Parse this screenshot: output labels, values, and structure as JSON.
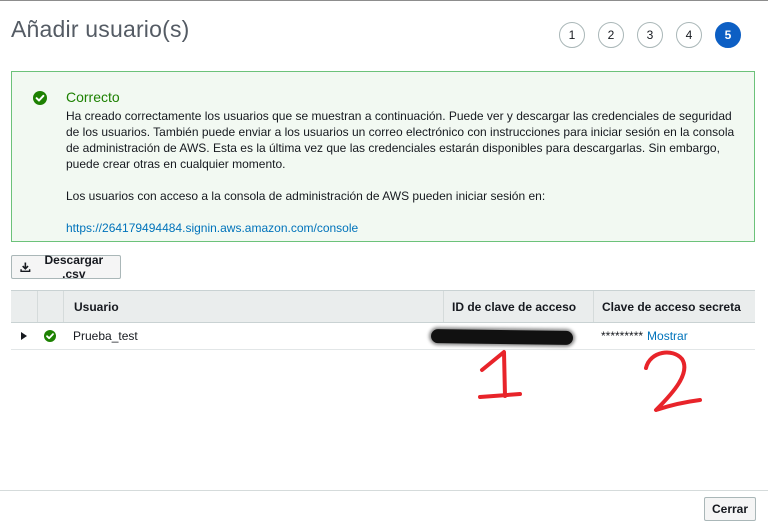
{
  "header": {
    "title": "Añadir usuario(s)",
    "steps": [
      "1",
      "2",
      "3",
      "4",
      "5"
    ],
    "active_step": "5"
  },
  "alert": {
    "icon": "check-circle-icon",
    "title": "Correcto",
    "body": "Ha creado correctamente los usuarios que se muestran a continuación. Puede ver y descargar las credenciales de seguridad de los usuarios. También puede enviar a los usuarios un correo electrónico con instrucciones para iniciar sesión en la consola de administración de AWS. Esta es la última vez que las credenciales estarán disponibles para descargarlas. Sin embargo, puede crear otras en cualquier momento.",
    "console_text": "Los usuarios con acceso a la consola de administración de AWS pueden iniciar sesión en:",
    "console_url": "https://264179494484.signin.aws.amazon.com/console"
  },
  "toolbar": {
    "download_label": "Descargar .csv",
    "download_icon": "download-icon"
  },
  "table": {
    "columns": [
      "Usuario",
      "ID de clave de acceso",
      "Clave de acceso secreta"
    ],
    "rows": [
      {
        "user": "Prueba_test",
        "access_key_id": "",
        "secret_masked": "*********",
        "show_label": "Mostrar"
      }
    ]
  },
  "annotations": [
    "1",
    "2"
  ],
  "footer": {
    "close_label": "Cerrar"
  },
  "colors": {
    "accent": "#0d5fc4",
    "success": "#1d8102",
    "link": "#0073bb",
    "annotation": "#e8242a"
  }
}
